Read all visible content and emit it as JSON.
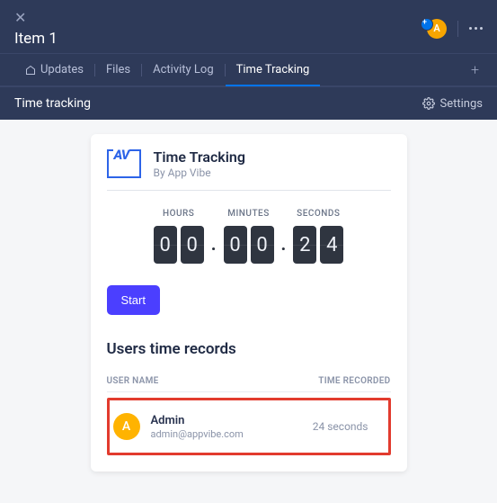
{
  "header": {
    "item_title": "Item 1",
    "avatar_initial": "A"
  },
  "tabs": {
    "updates": "Updates",
    "files": "Files",
    "activity_log": "Activity Log",
    "time_tracking": "Time Tracking"
  },
  "subheader": {
    "title": "Time tracking",
    "settings": "Settings"
  },
  "app": {
    "logo_text": "AV",
    "name": "Time Tracking",
    "by": "By App Vibe"
  },
  "timer": {
    "labels": {
      "hours": "HOURS",
      "minutes": "MINUTES",
      "seconds": "SECONDS"
    },
    "hours": {
      "d1": "0",
      "d2": "0"
    },
    "minutes": {
      "d1": "0",
      "d2": "0"
    },
    "seconds": {
      "d1": "2",
      "d2": "4"
    }
  },
  "buttons": {
    "start": "Start"
  },
  "records": {
    "title": "Users time records",
    "columns": {
      "user": "USER NAME",
      "time": "TIME RECORDED"
    },
    "row": {
      "avatar_initial": "A",
      "name": "Admin",
      "email": "admin@appvibe.com",
      "time_recorded": "24 seconds"
    }
  }
}
